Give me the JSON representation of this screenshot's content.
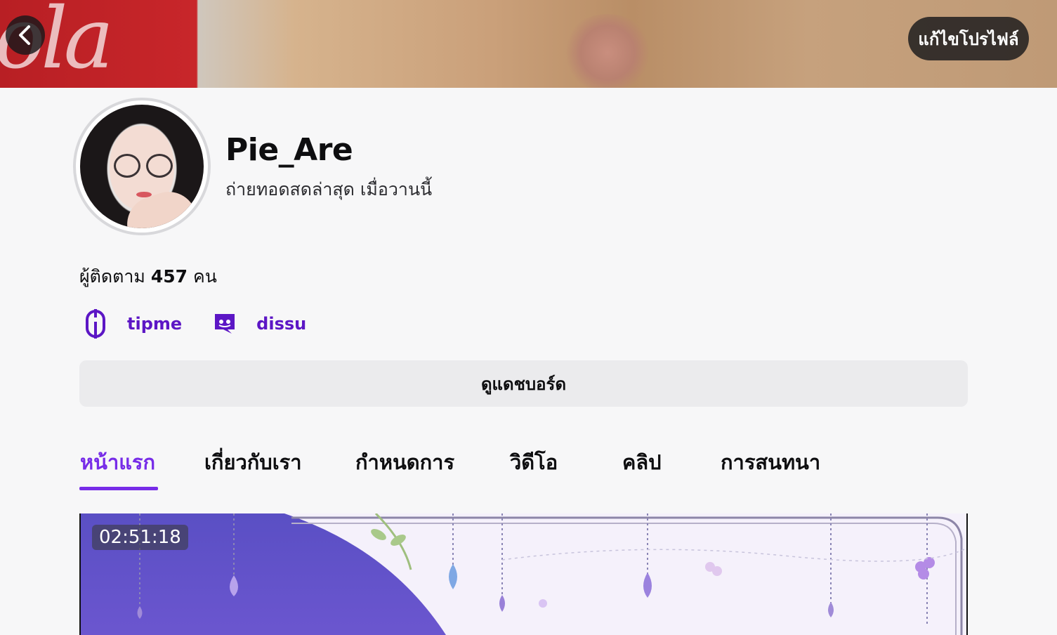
{
  "header": {
    "edit_profile_label": "แก้ไขโปรไฟล์",
    "back_icon": "chevron-left-icon"
  },
  "profile": {
    "username": "Pie_Are",
    "last_live": "ถ่ายทอดสดล่าสุด เมื่อวานนี้",
    "followers_prefix": "ผู้ติดตาม",
    "followers_count": "457",
    "followers_suffix": "คน"
  },
  "social_links": [
    {
      "label": "tipme",
      "icon": "tipme-icon"
    },
    {
      "label": "dissu",
      "icon": "discord-icon"
    }
  ],
  "dashboard_button": "ดูแดชบอร์ด",
  "tabs": [
    {
      "label": "หน้าแรก",
      "active": true
    },
    {
      "label": "เกี่ยวกับเรา",
      "active": false
    },
    {
      "label": "กำหนดการ",
      "active": false
    },
    {
      "label": "วิดีโอ",
      "active": false
    },
    {
      "label": "คลิป",
      "active": false
    },
    {
      "label": "การสนทนา",
      "active": false
    }
  ],
  "video": {
    "duration": "02:51:18"
  },
  "colors": {
    "accent": "#772ce8",
    "link": "#5c16c5",
    "background": "#f7f7f8",
    "button_bg": "#ebebed"
  }
}
